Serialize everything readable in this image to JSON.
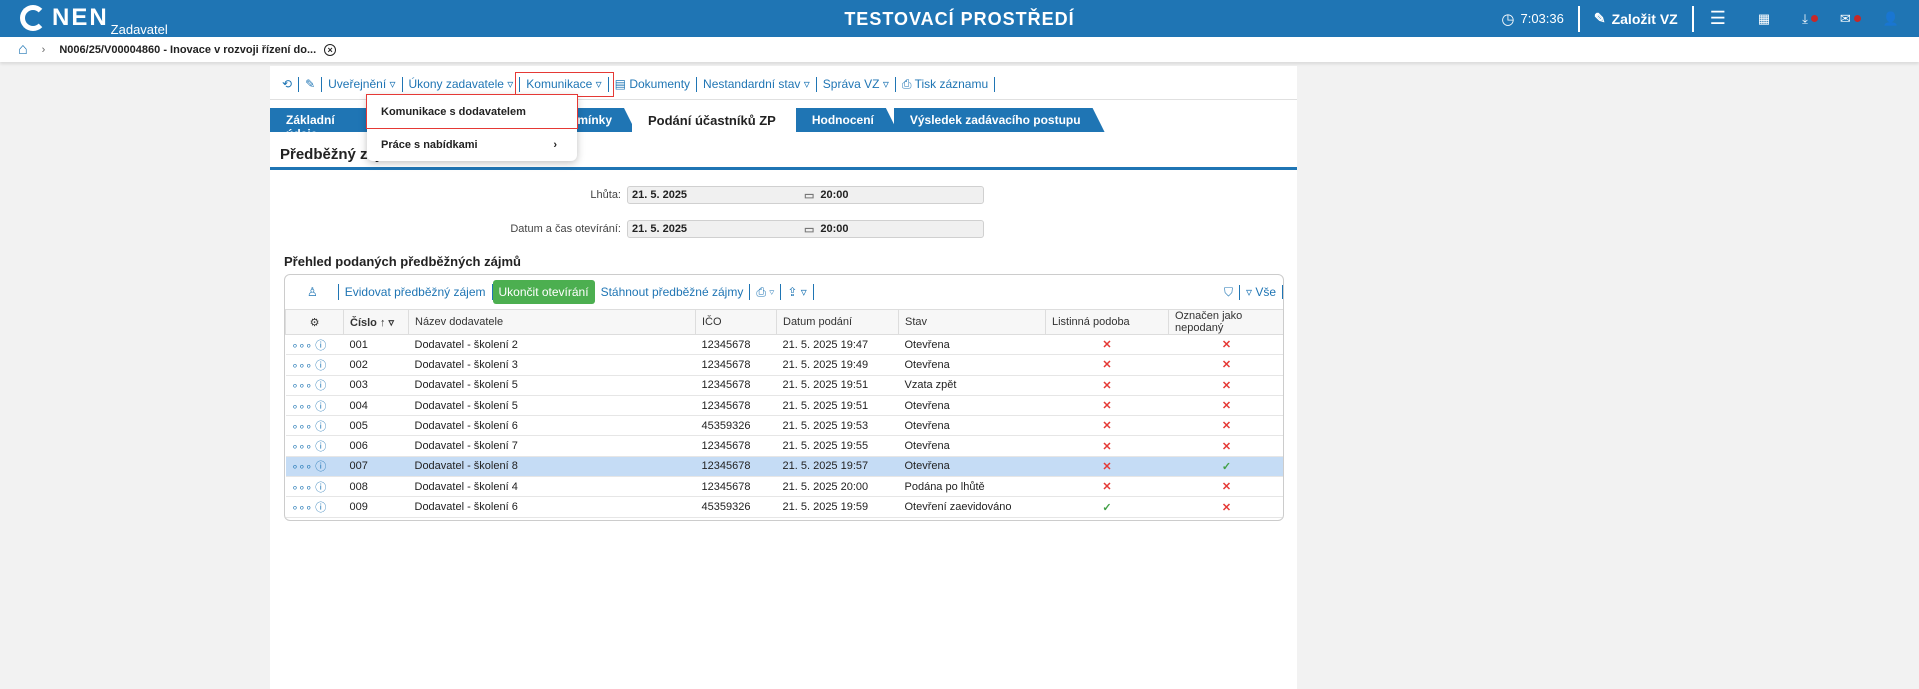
{
  "header": {
    "logo": "NEN",
    "logo_sub": "Zadavatel",
    "env": "TESTOVACÍ PROSTŘEDÍ",
    "time": "7:03:36",
    "create": "Založit VZ"
  },
  "breadcrumb": {
    "title": "N006/25/V00004860 - Inovace v rozvoji řízení do..."
  },
  "toolbar": [
    "Uveřejnění ▿",
    "Úkony zadavatele ▿",
    "Komunikace ▿",
    "Dokumenty",
    "Nestandardní stav ▿",
    "Správa VZ ▿",
    "Tisk záznamu"
  ],
  "menu": [
    "Komunikace s dodavatelem",
    "Práce s nabídkami"
  ],
  "tabs": [
    "Základní údaje",
    "odmínky",
    "Podání účastníků ZP",
    "Hodnocení",
    "Výsledek zadávacího postupu"
  ],
  "section_title": "Předběžný záj",
  "form": {
    "deadline_label": "Lhůta:",
    "deadline_date": "21. 5. 2025",
    "deadline_time": "20:00",
    "open_label": "Datum a čas otevírání:",
    "open_date": "21. 5. 2025",
    "open_time": "20:00"
  },
  "table_title": "Přehled podaných předběžných zájmů",
  "grid_toolbar": {
    "record": "Evidovat předběžný zájem",
    "finish": "Ukončit otevírání",
    "download": "Stáhnout předběžné zájmy",
    "all": "Vše"
  },
  "columns": [
    "Číslo",
    "Název dodavatele",
    "IČO",
    "Datum podání",
    "Stav",
    "Listinná podoba",
    "Označen jako nepodaný"
  ],
  "rows": [
    [
      "001",
      "Dodavatel - školení 2",
      "12345678",
      "21. 5. 2025 19:47",
      "Otevřena",
      false,
      false
    ],
    [
      "002",
      "Dodavatel - školení 3",
      "12345678",
      "21. 5. 2025 19:49",
      "Otevřena",
      false,
      false
    ],
    [
      "003",
      "Dodavatel - školení 5",
      "12345678",
      "21. 5. 2025 19:51",
      "Vzata zpět",
      false,
      false
    ],
    [
      "004",
      "Dodavatel - školení 5",
      "12345678",
      "21. 5. 2025 19:51",
      "Otevřena",
      false,
      false
    ],
    [
      "005",
      "Dodavatel - školení 6",
      "45359326",
      "21. 5. 2025 19:53",
      "Otevřena",
      false,
      false
    ],
    [
      "006",
      "Dodavatel - školení 7",
      "12345678",
      "21. 5. 2025 19:55",
      "Otevřena",
      false,
      false
    ],
    [
      "007",
      "Dodavatel - školení 8",
      "12345678",
      "21. 5. 2025 19:57",
      "Otevřena",
      false,
      true
    ],
    [
      "008",
      "Dodavatel - školení 4",
      "12345678",
      "21. 5. 2025 20:00",
      "Podána po lhůtě",
      false,
      false
    ],
    [
      "009",
      "Dodavatel - školení 6",
      "45359326",
      "21. 5. 2025 19:59",
      "Otevření zaevidováno",
      true,
      false
    ]
  ],
  "selected_row": 6
}
